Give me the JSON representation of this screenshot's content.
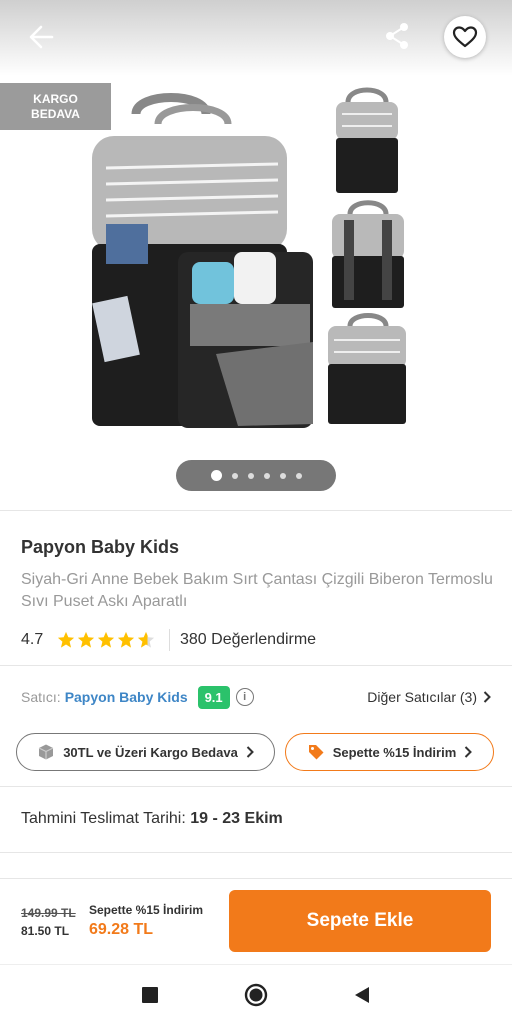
{
  "gallery": {
    "badge_line1": "KARGO",
    "badge_line2": "BEDAVA",
    "dot_count": 6,
    "active_dot": 1
  },
  "product": {
    "brand": "Papyon Baby Kids",
    "title": "Siyah-Gri Anne Bebek Bakım Sırt Çantası Çizgili Biberon Termoslu Sıvı Puset Askı Aparatlı",
    "rating": "4.7",
    "rating_value": 4.7,
    "reviews": "380 Değerlendirme"
  },
  "seller": {
    "label": "Satıcı:",
    "name": "Papyon Baby Kids",
    "score": "9.1",
    "other": "Diğer Satıcılar (3)"
  },
  "pills": {
    "cargo": "30TL ve Üzeri Kargo Bedava",
    "promo": "Sepette %15 İndirim"
  },
  "delivery": {
    "label": "Tahmini Teslimat Tarihi:",
    "dates": "19 - 23 Ekim"
  },
  "buybar": {
    "old_price": "149.99 TL",
    "mid_price": "81.50 TL",
    "promo_label": "Sepette %15 İndirim",
    "final_price": "69.28 TL",
    "add_button": "Sepete Ekle"
  },
  "colors": {
    "accent": "#f27a1a",
    "seller_link": "#3e86c6",
    "score_badge": "#2bc26b"
  },
  "icons": [
    "back-arrow-icon",
    "share-icon",
    "heart-icon",
    "star-icon",
    "info-icon",
    "chevron-right-icon",
    "box-icon",
    "tag-icon",
    "square-icon",
    "circle-icon",
    "triangle-back-icon"
  ]
}
